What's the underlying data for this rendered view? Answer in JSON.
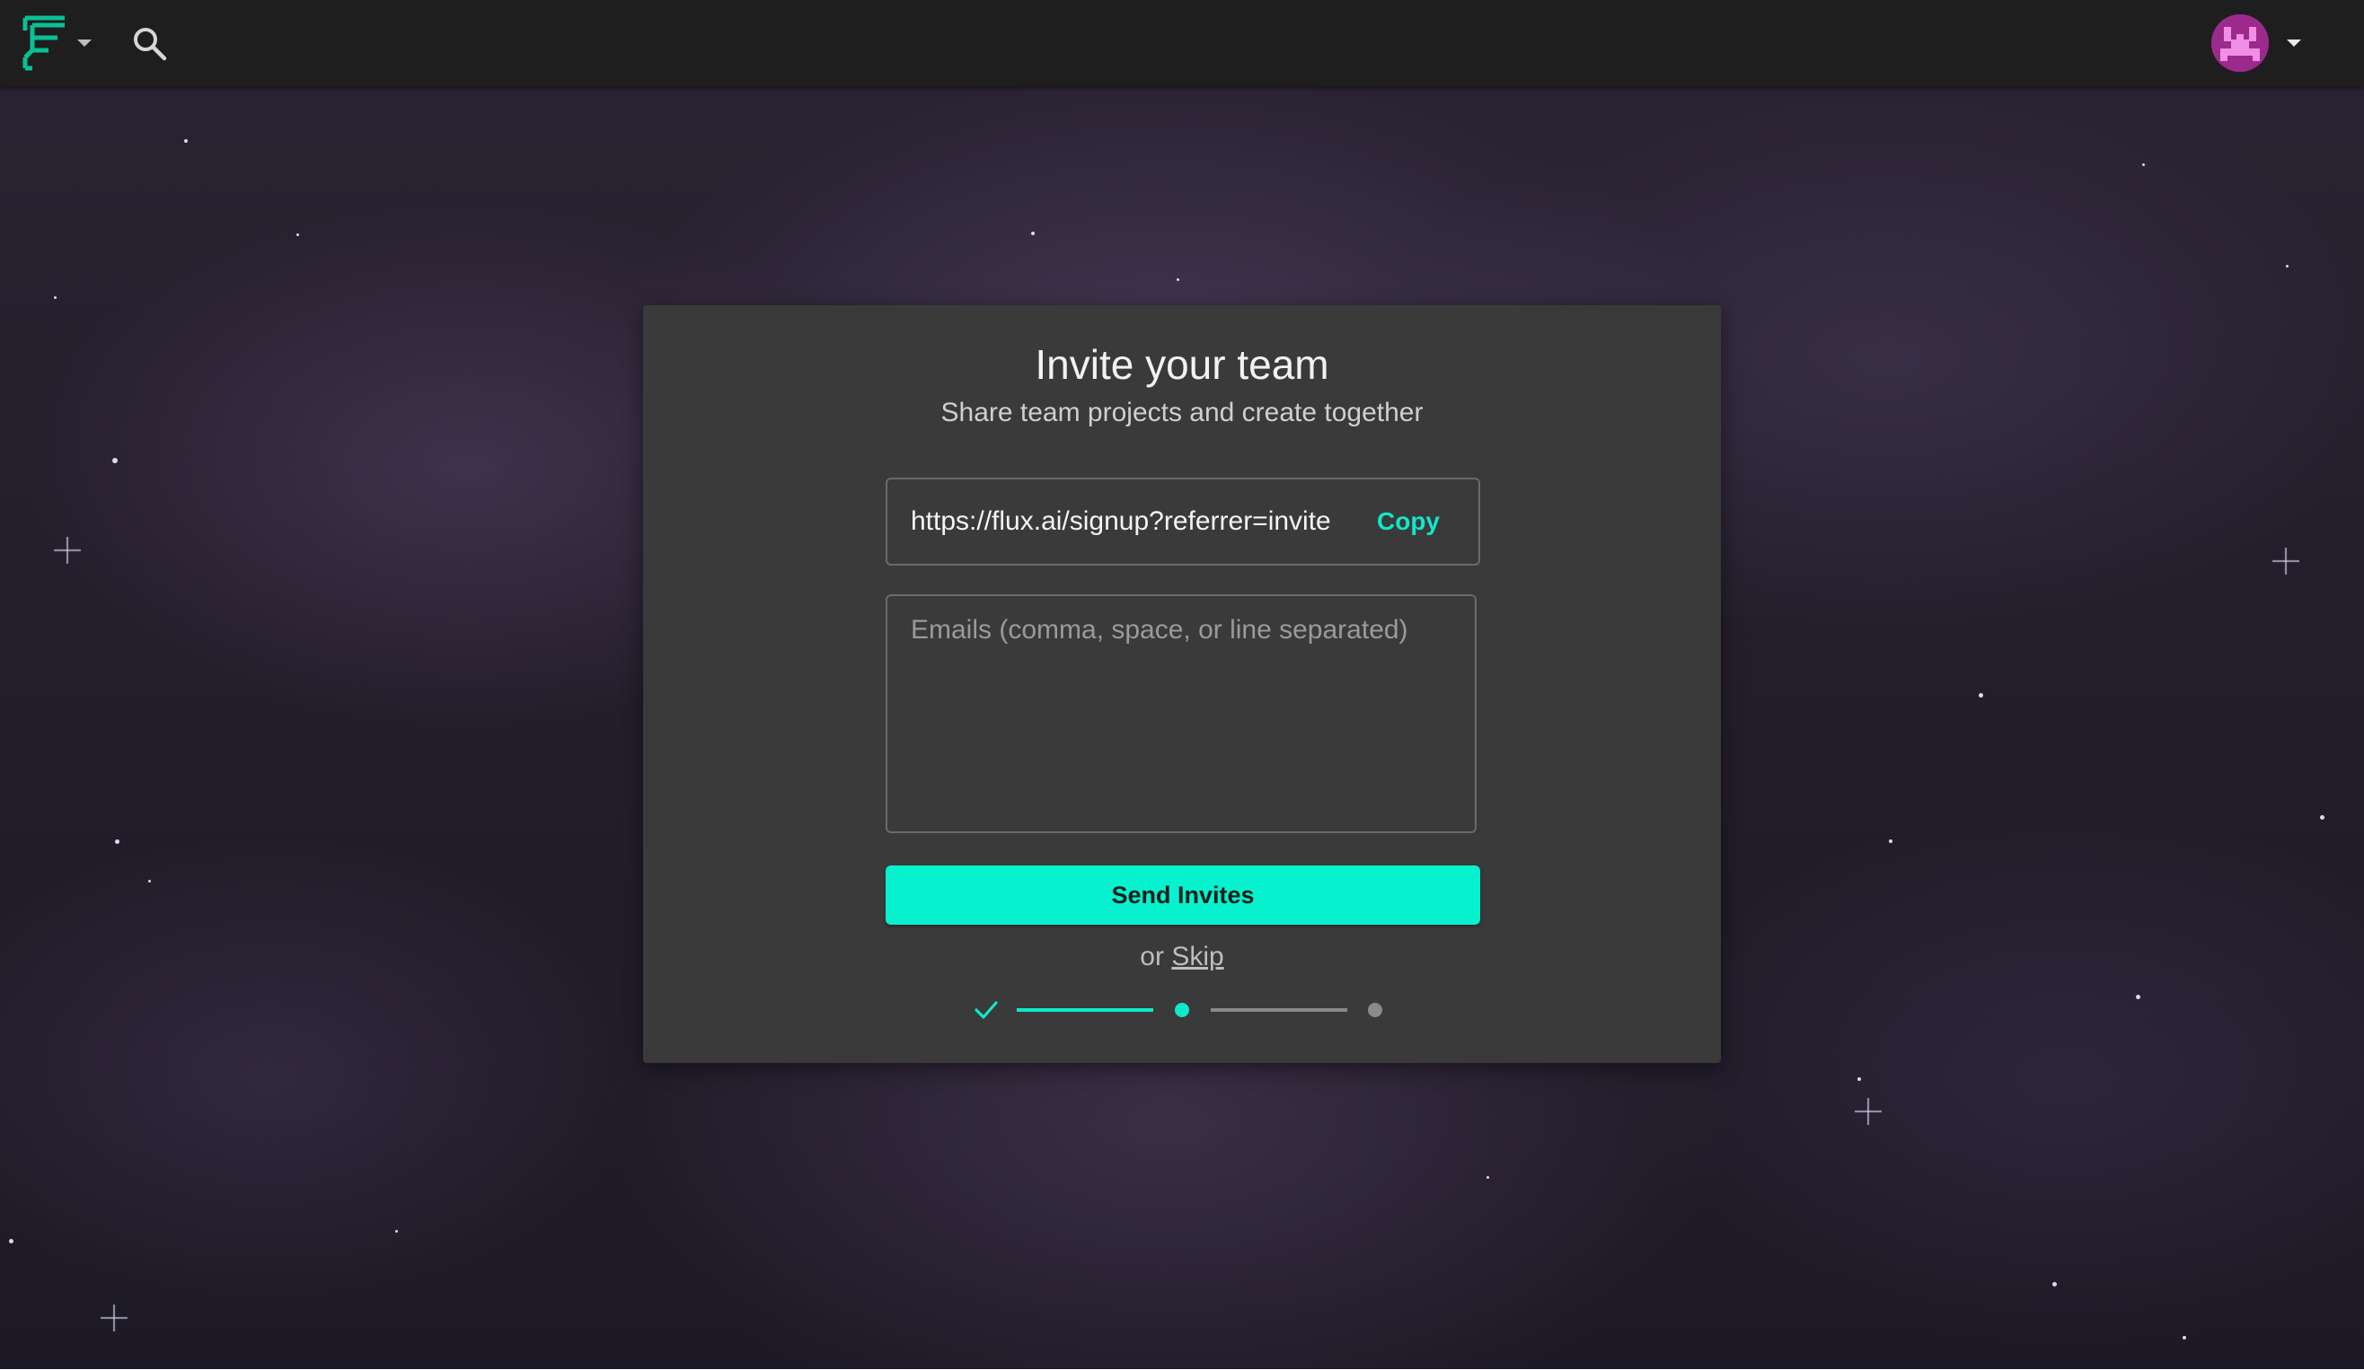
{
  "header": {
    "logo_icon": "flux-logo-icon",
    "search_icon": "search-icon",
    "avatar_icon": "pixel-avatar-icon"
  },
  "invite": {
    "title": "Invite your team",
    "subtitle": "Share team projects and create together",
    "link_value": "https://flux.ai/signup?referrer=invite",
    "copy_label": "Copy",
    "emails_placeholder": "Emails (comma, space, or line separated)",
    "emails_value": "",
    "send_label": "Send Invites",
    "or_text": "or",
    "skip_label": "Skip"
  },
  "stepper": {
    "total_steps": 3,
    "current_step": 2,
    "completed_steps": 1
  },
  "colors": {
    "accent": "#06f2cf",
    "topbar": "#1e1e1e",
    "card": "#3a3a3a",
    "avatar": "#9c2a8c"
  }
}
